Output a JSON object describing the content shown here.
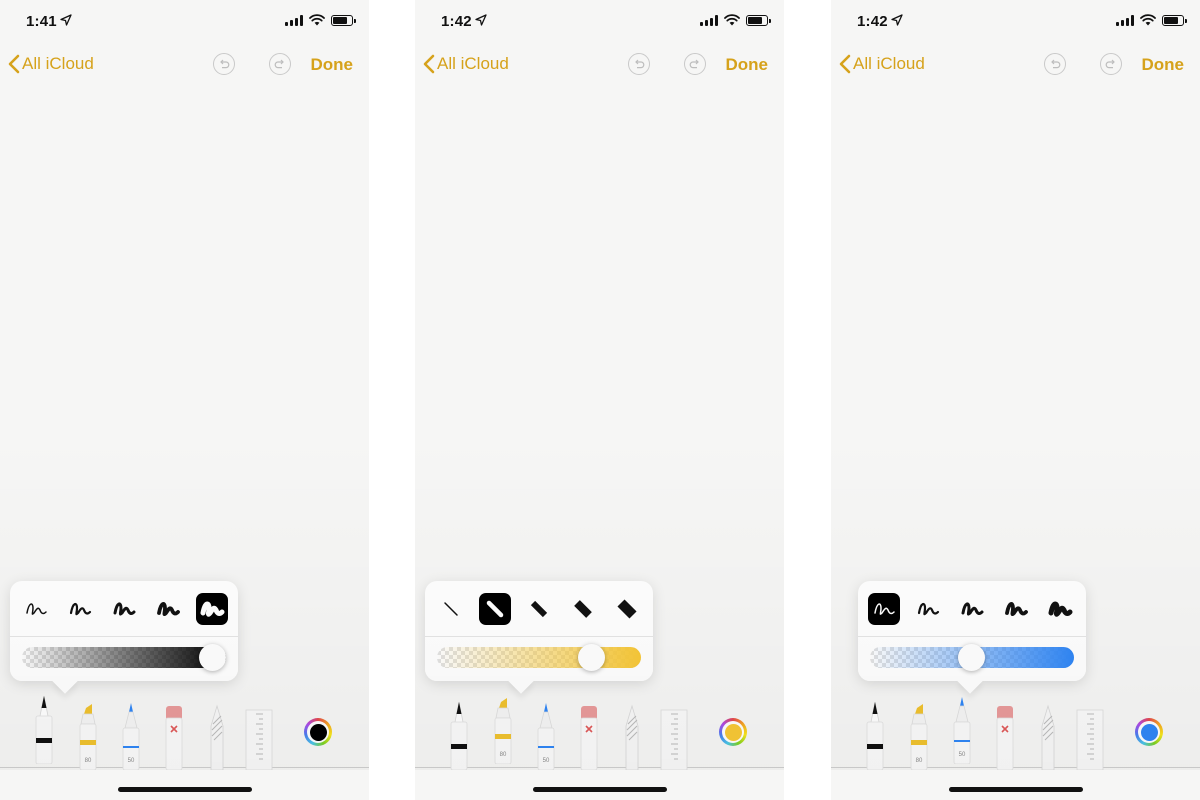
{
  "phones": [
    {
      "status": {
        "time": "1:41"
      },
      "nav": {
        "back_label": "All iCloud",
        "done_label": "Done"
      },
      "selected_tool": "pen",
      "selected_thickness_index": 4,
      "opacity_value": 1.0,
      "ink_color": "#000000",
      "thickness_style": "squiggle",
      "tool_labels": {
        "marker": "80",
        "pencil_blue": "50"
      }
    },
    {
      "status": {
        "time": "1:42"
      },
      "nav": {
        "back_label": "All iCloud",
        "done_label": "Done"
      },
      "selected_tool": "marker",
      "selected_thickness_index": 1,
      "opacity_value": 0.8,
      "ink_color": "#f8c836",
      "thickness_style": "bar",
      "tool_labels": {
        "marker": "80",
        "pencil_blue": "50"
      }
    },
    {
      "status": {
        "time": "1:42"
      },
      "nav": {
        "back_label": "All iCloud",
        "done_label": "Done"
      },
      "selected_tool": "pencil",
      "selected_thickness_index": 0,
      "opacity_value": 0.5,
      "ink_color": "#2f86f6",
      "thickness_style": "squiggle",
      "tool_labels": {
        "marker": "80",
        "pencil_blue": "50"
      }
    }
  ],
  "colors": {
    "accent": "#d6a21b",
    "marker_yellow": "#f0c22e",
    "pencil_blue": "#2f86f6",
    "eraser_pink": "#e99a9a"
  }
}
